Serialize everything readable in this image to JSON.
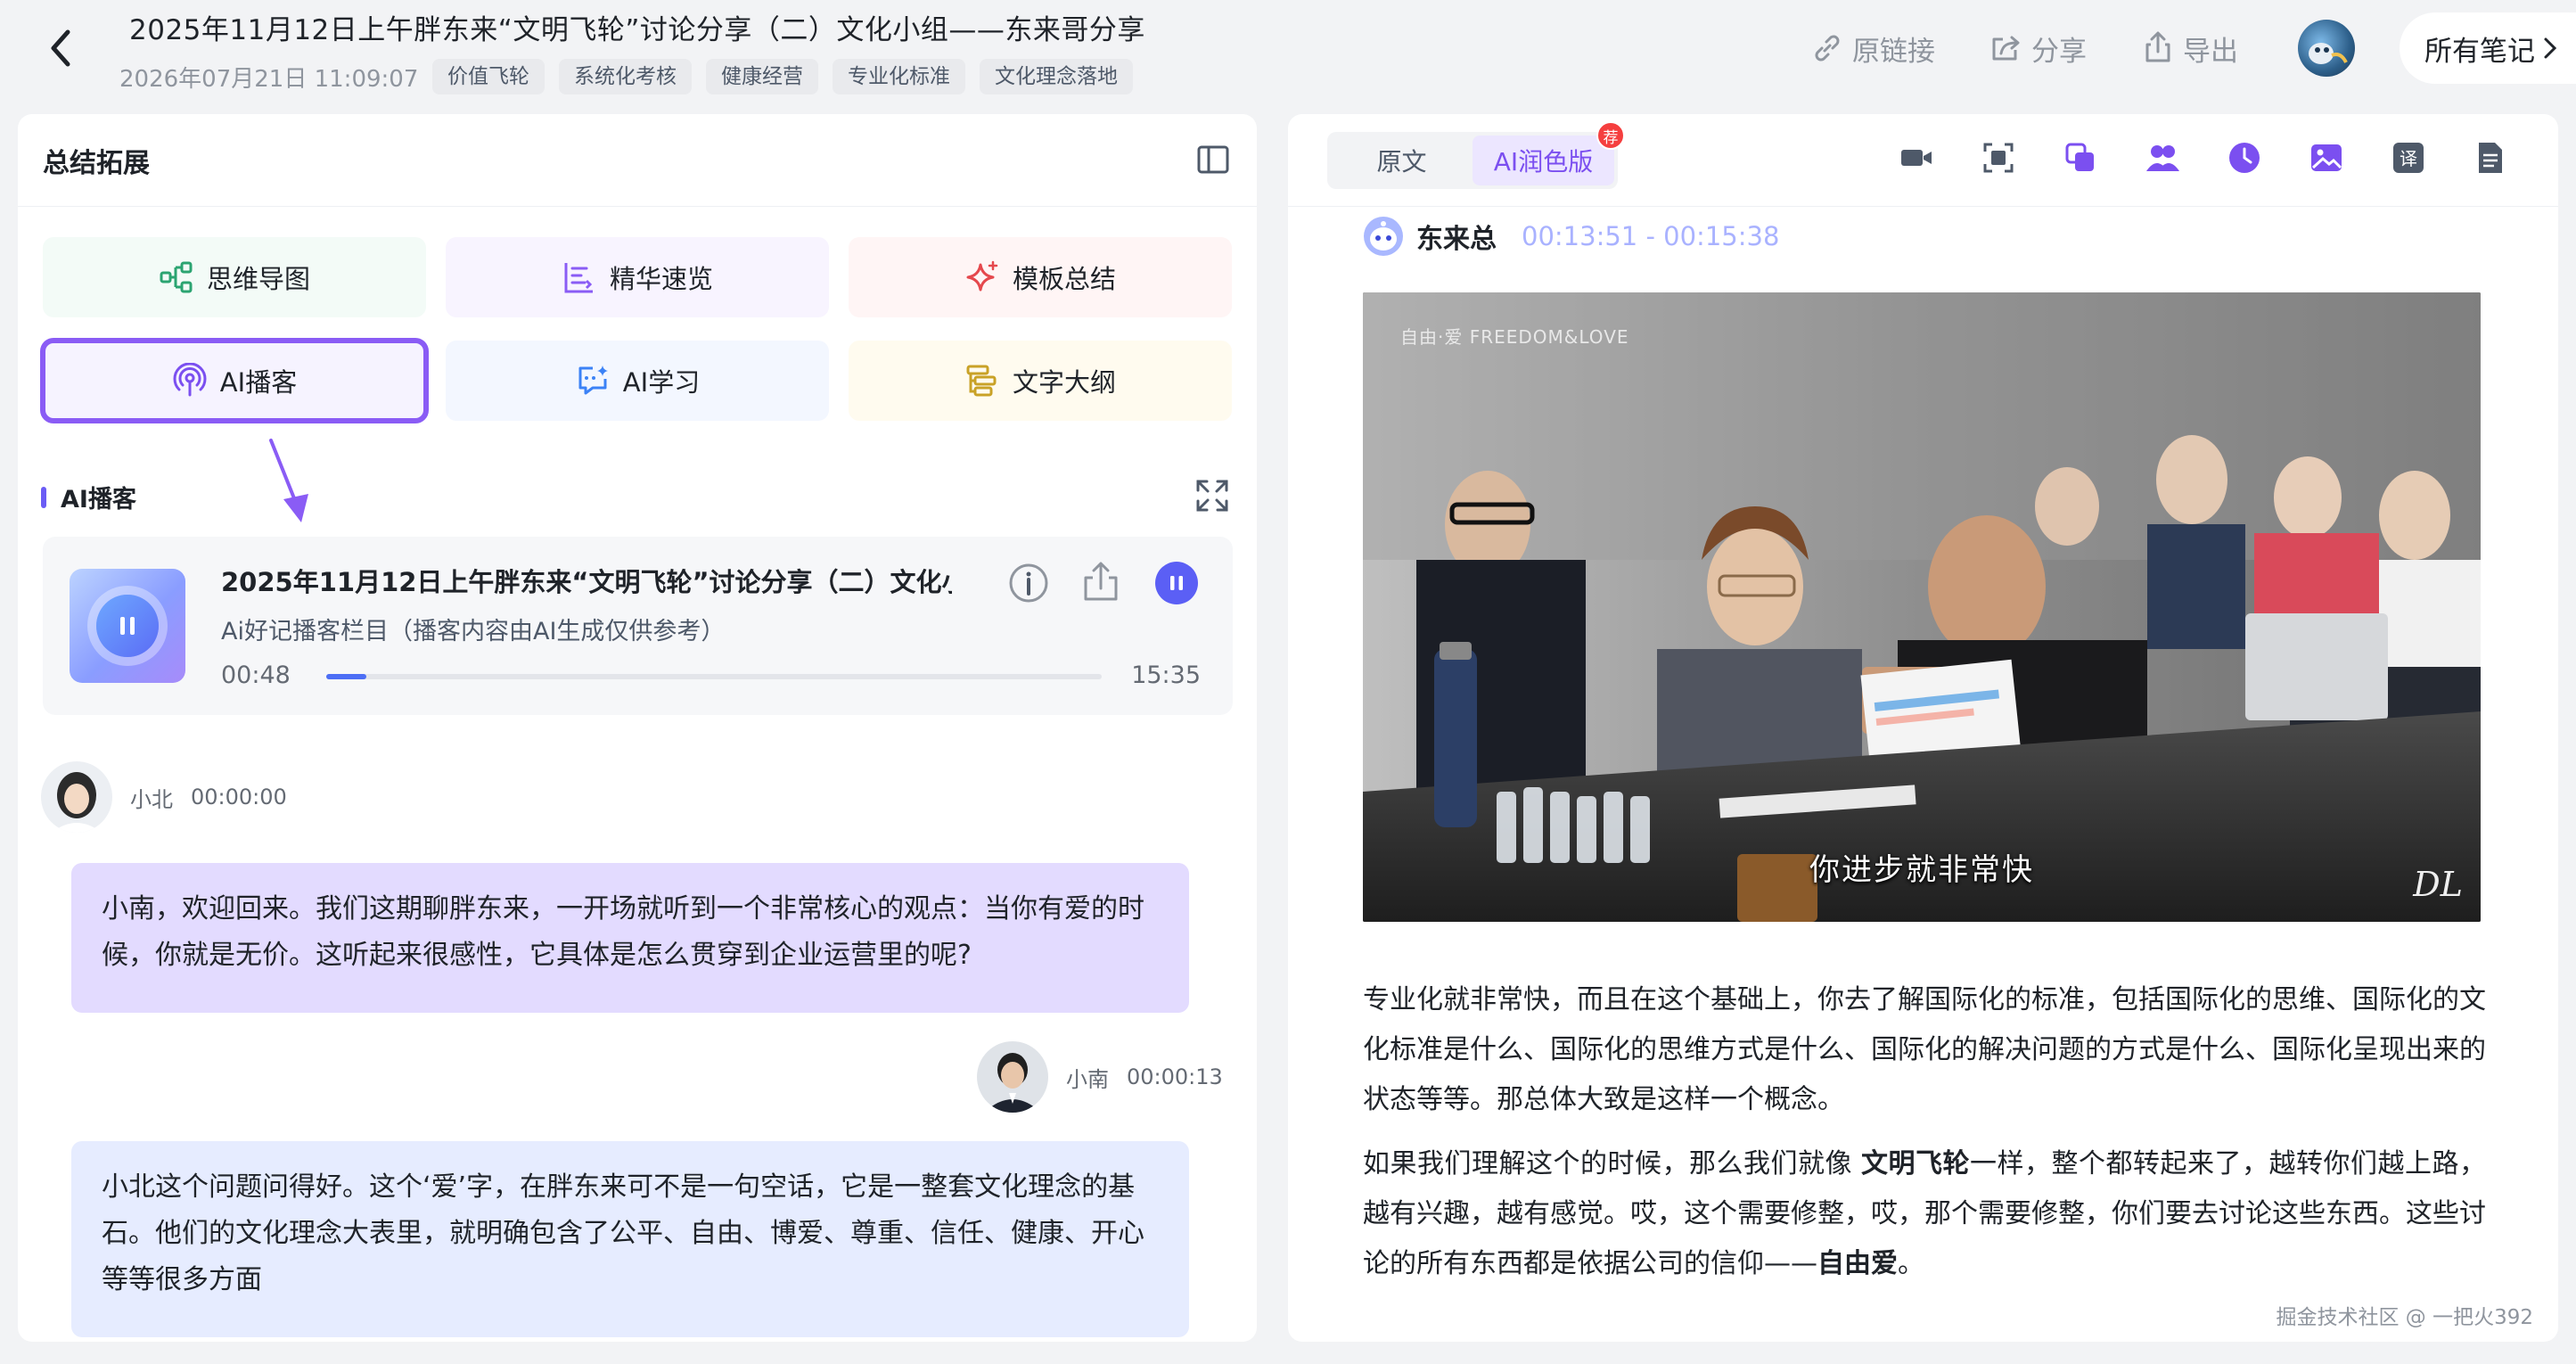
{
  "header": {
    "title": "2025年11月12日上午胖东来“文明飞轮”讨论分享（二）文化小组——东来哥分享",
    "date": "2026年07月21日 11:09:07",
    "tags": [
      "价值飞轮",
      "系统化考核",
      "健康经营",
      "专业化标准",
      "文化理念落地"
    ],
    "actions": [
      {
        "label": "原链接",
        "icon": "link-icon"
      },
      {
        "label": "分享",
        "icon": "share-icon"
      },
      {
        "label": "导出",
        "icon": "export-icon"
      }
    ],
    "all_notes": "所有笔记"
  },
  "left": {
    "title": "总结拓展",
    "cards": [
      {
        "label": "思维导图",
        "icon": "mindmap-icon",
        "color": "#2ba471",
        "bg": "#f3fbf7"
      },
      {
        "label": "精华速览",
        "icon": "list-icon",
        "color": "#8a5cf5",
        "bg": "#f8f4ff"
      },
      {
        "label": "模板总结",
        "icon": "sparkle-icon",
        "color": "#e5484d",
        "bg": "#fff5f5"
      },
      {
        "label": "AI播客",
        "icon": "podcast-icon",
        "color": "#7b4ff0",
        "bg": "#f6f3ff"
      },
      {
        "label": "AI学习",
        "icon": "chat-sparkle-icon",
        "color": "#3b82f6",
        "bg": "#f3f7ff"
      },
      {
        "label": "文字大纲",
        "icon": "outline-icon",
        "color": "#c9a227",
        "bg": "#fffbef"
      }
    ],
    "section_label": "AI播客",
    "player": {
      "title": "2025年11月12日上午胖东来“文明飞轮”讨论分享（二）文化小组...",
      "subtitle": "Ai好记播客栏目（播客内容由AI生成仅供参考）",
      "current": "00:48",
      "total": "15:35",
      "progress": 0.052
    },
    "dialogue": [
      {
        "speaker": "小北",
        "time": "00:00:00",
        "text": "小南，欢迎回来。我们这期聊胖东来，一开场就听到一个非常核心的观点：当你有爱的时候，你就是无价。这听起来很感性，它具体是怎么贯穿到企业运营里的呢?"
      },
      {
        "speaker": "小南",
        "time": "00:00:13",
        "text": ""
      },
      {
        "speaker": "",
        "time": "",
        "text": "小北这个问题问得好。这个‘爱’字，在胖东来可不是一句空话，它是一整套文化理念的基石。他们的文化理念大表里，就明确包含了公平、自由、博爱、尊重、信任、健康、开心等等很多方面"
      }
    ]
  },
  "right": {
    "segments": [
      {
        "label": "原文",
        "active": false
      },
      {
        "label": "AI润色版",
        "active": true
      }
    ],
    "badge": "荐",
    "tools": [
      "video-icon",
      "screenshot-icon",
      "copy-icon",
      "speakers-icon",
      "clock-icon",
      "image-icon",
      "translate-icon",
      "document-icon"
    ],
    "speaker_name": "东来总",
    "speaker_time": "00:13:51 - 00:15:38",
    "video": {
      "watermark": "自由·爱  FREEDOM&LOVE",
      "subtitle": "你进步就非常快",
      "logo": "DL"
    },
    "paragraph1": "专业化就非常快，而且在这个基础上，你去了解国际化的标准，包括国际化的思维、国际化的文化标准是什么、国际化的思维方式是什么、国际化的解决问题的方式是什么、国际化呈现出来的状态等等。那总体大致是这样一个概念。",
    "paragraph2_a": "如果我们理解这个的时候，那么我们就像 ",
    "paragraph2_bold1": "文明飞轮",
    "paragraph2_b": "一样，整个都转起来了，越转你们越上路，越有兴趣，越有感觉。哎，这个需要修整，哎，那个需要修整，你们要去讨论这些东西。这些讨论的所有东西都是依据公司的信仰——",
    "paragraph2_bold2": "自由爱",
    "paragraph2_c": "。",
    "credit": "掘金技术社区 @ 一把火392"
  }
}
